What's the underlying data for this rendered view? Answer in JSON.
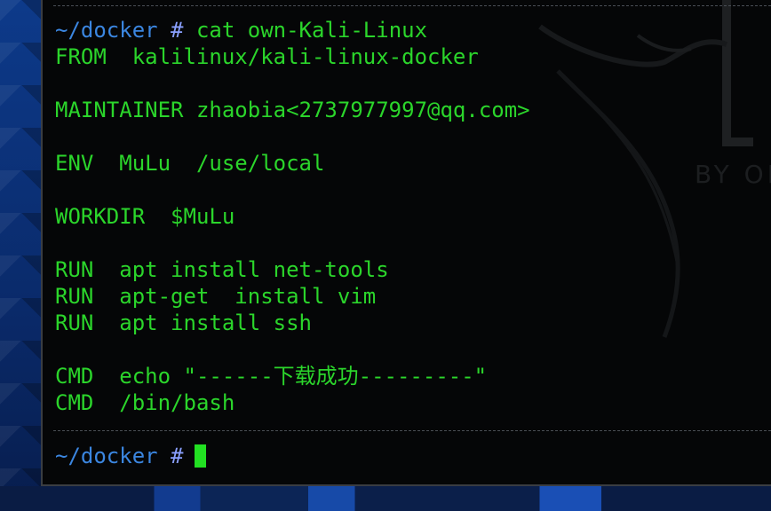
{
  "terminal": {
    "prompt": {
      "path": "~/docker",
      "symbol": "#"
    },
    "command": "cat own-Kali-Linux",
    "output_lines": [
      "FROM  kalilinux/kali-linux-docker",
      "",
      "MAINTAINER zhaobia<2737977997@qq.com>",
      "",
      "ENV  MuLu  /use/local",
      "",
      "WORKDIR  $MuLu",
      "",
      "RUN  apt install net-tools",
      "RUN  apt-get  install vim",
      "RUN  apt install ssh",
      "",
      "CMD  echo \"------下载成功---------\"",
      "CMD  /bin/bash"
    ],
    "watermark_text": "BY OF",
    "colors": {
      "output": "#2bd52b",
      "path": "#3b86e0",
      "background": "#050607"
    }
  }
}
